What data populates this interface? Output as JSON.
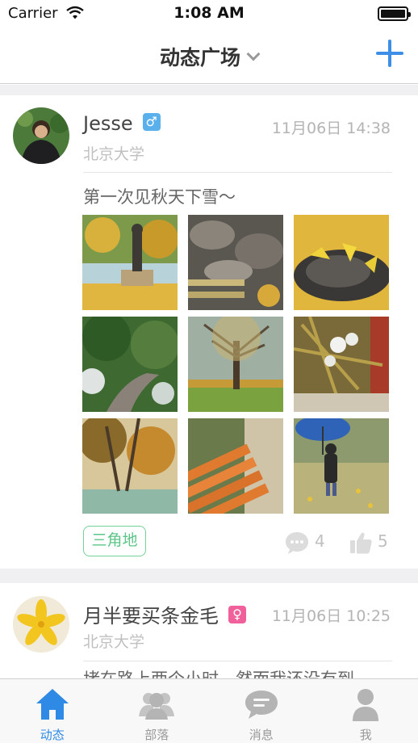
{
  "status_bar": {
    "carrier": "Carrier",
    "time": "1:08 AM"
  },
  "navbar": {
    "title": "动态广场",
    "add_icon": "plus-icon",
    "accent": "#3d8ee6"
  },
  "posts": [
    {
      "author": "Jesse",
      "gender": "male",
      "gender_symbol": "♂",
      "time": "11月06日 14:38",
      "school": "北京大学",
      "text": "第一次见秋天下雪～",
      "tag": "三角地",
      "comments": "4",
      "likes": "5"
    },
    {
      "author": "月半要买条金毛",
      "gender": "female",
      "gender_symbol": "♀",
      "time": "11月06日 10:25",
      "school": "北京大学",
      "text": "堵在路上两个小时，然而我还没有到"
    }
  ],
  "tabs": [
    {
      "label": "动态",
      "icon": "home-icon",
      "active": true
    },
    {
      "label": "部落",
      "icon": "group-icon",
      "active": false
    },
    {
      "label": "消息",
      "icon": "message-icon",
      "active": false
    },
    {
      "label": "我",
      "icon": "person-icon",
      "active": false
    }
  ]
}
